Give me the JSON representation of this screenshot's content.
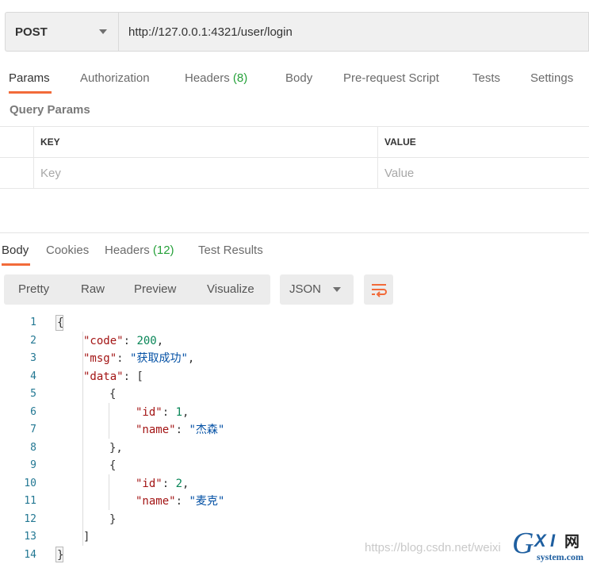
{
  "request": {
    "method": "POST",
    "url": "http://127.0.0.1:4321/user/login"
  },
  "request_tabs": {
    "params": "Params",
    "authorization": "Authorization",
    "headers": "Headers",
    "headers_count": "(8)",
    "body": "Body",
    "pre_request": "Pre-request Script",
    "tests": "Tests",
    "settings": "Settings"
  },
  "query_params": {
    "title": "Query Params",
    "key_header": "KEY",
    "value_header": "VALUE",
    "key_placeholder": "Key",
    "value_placeholder": "Value"
  },
  "response_tabs": {
    "body": "Body",
    "cookies": "Cookies",
    "headers": "Headers",
    "headers_count": "(12)",
    "test_results": "Test Results"
  },
  "toolbar": {
    "pretty": "Pretty",
    "raw": "Raw",
    "preview": "Preview",
    "visualize": "Visualize",
    "format": "JSON"
  },
  "code_lines": [
    {
      "n": "1",
      "t": "{"
    },
    {
      "n": "2",
      "t": "\"code\": 200,"
    },
    {
      "n": "3",
      "t": "\"msg\": \"获取成功\","
    },
    {
      "n": "4",
      "t": "\"data\": ["
    },
    {
      "n": "5",
      "t": "{"
    },
    {
      "n": "6",
      "t": "\"id\": 1,"
    },
    {
      "n": "7",
      "t": "\"name\": \"杰森\""
    },
    {
      "n": "8",
      "t": "},"
    },
    {
      "n": "9",
      "t": "{"
    },
    {
      "n": "10",
      "t": "\"id\": 2,"
    },
    {
      "n": "11",
      "t": "\"name\": \"麦克\""
    },
    {
      "n": "12",
      "t": "}"
    },
    {
      "n": "13",
      "t": "]"
    },
    {
      "n": "14",
      "t": "}"
    }
  ],
  "watermark": "https://blog.csdn.net/weixi",
  "logo": {
    "brand": "GXI",
    "suffix": "网",
    "site": "system.com"
  },
  "colors": {
    "accent": "#f26b3a",
    "count": "#26a13a",
    "json_key": "#a31515",
    "json_number": "#098658",
    "json_string": "#0451a5"
  }
}
